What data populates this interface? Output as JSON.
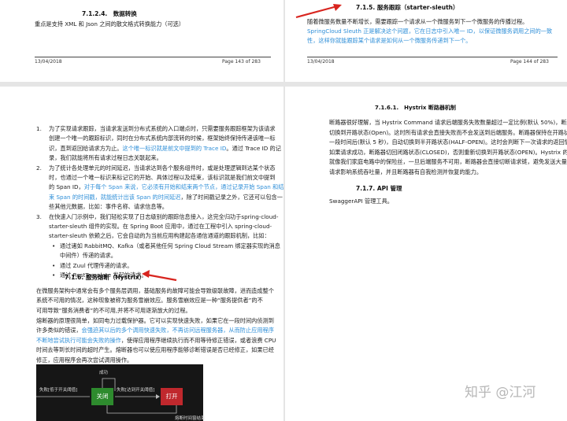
{
  "top_left_page": {
    "heading": "7.1.2.4.　数据转换",
    "body": "重点是支持 XML 和 Json 之间的散文格式转换能力（可选）",
    "date": "13/04/2018",
    "page_no": "Page 143 of 283"
  },
  "top_right_page": {
    "heading": "7.1.5.  服务跟踪（starter-sleuth）",
    "body_1": "随着微服务数量不断增长，需要跟踪一个请求从一个微服务到下一个微服务的传播过程。",
    "body_1_blue": "Spring",
    "body_2_blue": "Cloud Sleuth 正是解决这个问题，它在日志中引入唯一 ID，以保证微服务调用之间的一致性，这样你就能跟踪某个请求是如何从一个微服务传递到下一个。",
    "date": "13/04/2018",
    "page_no": "Page 144 of 283"
  },
  "left_page": {
    "items": [
      {
        "num": "1.",
        "lines": [
          {
            "text": "为了实现请求跟踪，当请求发送到分布式系统的入口端点时，只需要服务跟踪框架为该请求"
          },
          {
            "text": "创建一个唯一的跟踪标识，同时在分布式系统内部流转的时候，框架始终保持传递该唯一标"
          },
          {
            "text": "识，直到返回给请求方为止。",
            "blue": "这个唯一标识就是前文中提到的 Trace ID",
            "after": "。通过 Trace ID 的记"
          },
          {
            "text": "录，我们就能将所有请求过程日志关联起来。"
          }
        ]
      },
      {
        "num": "2.",
        "lines": [
          {
            "text": "为了统计各处理单元的时间延迟，当请求达到各个服务组件时，或是处理逻辑到达某个状态"
          },
          {
            "text": "时，也通过一个唯一标识来标记它的开始、具体过程以及结束，该标识就是我们前文中提到"
          },
          {
            "text": "的 Span ID，",
            "blue": "对于每个 Span 来说，它必须有开始和结束两个节点，通过记录开始 Span 和结"
          },
          {
            "text": "",
            "blue": "束 Span 的时间戳，就能统计出该 Span 的时间延迟",
            "after": "，除了时间戳记录之外，它还可以包含一"
          },
          {
            "text": "些其他元数据，比如：事件名称、请求信息等。"
          }
        ]
      },
      {
        "num": "3.",
        "lines": [
          {
            "text": "在快速入门示例中，我们轻松实现了日志级别的跟踪信息接入，这完全归功于spring-cloud-"
          },
          {
            "text": "starter-sleuth 组件的实现。在 Spring Boot 应用中，通过在工程中引入 spring-cloud-"
          },
          {
            "text": "starter-sleuth 依赖之后，它会自动的为当前应用构建起各通信通道的跟踪机制，比如："
          }
        ]
      }
    ],
    "bullets": [
      "通过诸如 RabbitMQ、Kafka（或者其他任何 Spring Cloud Stream 绑定器实现的消息",
      "中间件）传递的请求。",
      "通过 Zuul 代理传递的请求。",
      "通过 RestTemplate 发起的请求。"
    ],
    "section_heading": "7.1.6.  服务熔断（Hystrix）",
    "para1": [
      "在微服务架构中通常会有多个服务层调用，基础服务的故障可能会导致级联故障，进而造成整个",
      "系统不可用的情况，这种现象被称为服务雪崩效应。服务雪崩效应是一种“服务提供者”的不",
      "可用导致“服务消费者”的不可用,并将不可用逐渐放大的过程。"
    ],
    "para2": [
      {
        "text": "熔断器的原理很简单，如同电力过载保护器。它可以实现快速失败，如果它在一段时间内侦测到"
      },
      {
        "text": "许多类似的错误，",
        "blue": "会强迫其以后的多个调用快速失败，不再访问远程服务器，从而防止应用程序"
      },
      {
        "text": "",
        "blue": "不断地尝试执行可能会失败的操作",
        "after": "，使得应用程序继续执行而不用等待修正错误，或者浪费 CPU"
      },
      {
        "text": "时间去等到长时间的超时产生。熔断器也可以使应用程序能够诊断错误是否已经修正，如果已经"
      },
      {
        "text": "修正，应用程序会再次尝试调用操作。"
      }
    ],
    "diagram": {
      "success": "成功",
      "fail_below": "失败[低于开关阈值]",
      "fail_reached": "失败[达到开关阈值]",
      "closed": "关闭",
      "open": "打开",
      "timeout": "熔断时间窗结束",
      "closed_color": "#2e8b2e",
      "open_color": "#c0282d"
    }
  },
  "right_page": {
    "heading_1": "7.1.6.1.　Hystrix 断路器机制",
    "body": [
      "断路器很好理解，当 Hystrix Command 请求后端服务失败数量超过一定比例(默认 50%)，断路器会",
      "切换到开路状态(Open)。这时所有请求会直接失败而不会发送到后端服务。断路器保持在开路状态",
      "一段时间后(默认 5 秒)，自动切换到半开路状态(HALF-OPEN)。这时会判断下一次请求的返回情况，",
      "如果请求成功，断路器切回闭路状态(CLOSED)，否则重新切换到开路状态(OPEN)。Hystrix 的断路器",
      "就像我们家庭电路中的保险丝，一旦后端服务不可用，断路器会直接切断请求链，避免发送大量无效",
      "请求影响系统吞吐量，并且断路器有自我检测并恢复的能力。"
    ],
    "heading_2": "7.1.7.  API 管理",
    "body_2": "SwaggerAPI 管理工具。"
  },
  "watermark": {
    "text": "知乎 @江河"
  }
}
